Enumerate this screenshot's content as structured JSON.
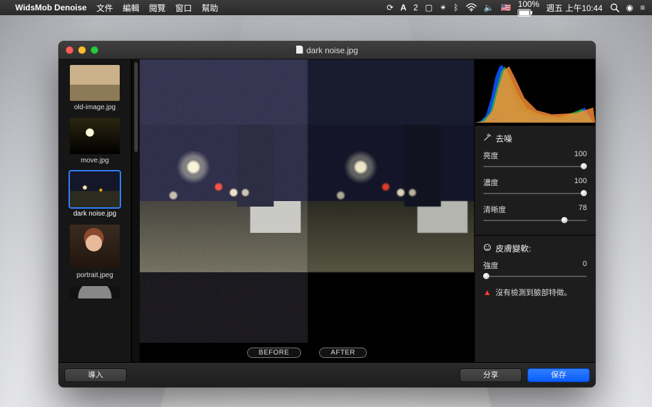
{
  "menubar": {
    "app": "WidsMob Denoise",
    "items": [
      "文件",
      "編輯",
      "閱覽",
      "窗口",
      "幫助"
    ],
    "status": {
      "network_icon": "wifi-icon",
      "flag": "🇺🇸",
      "battery": "100%",
      "charging_icon": "⚡",
      "datetime": "週五 上午10:44"
    }
  },
  "window": {
    "title": "dark noise.jpg"
  },
  "thumbnails": [
    {
      "label": "old-image.jpg",
      "cls": "th-old"
    },
    {
      "label": "move.jpg",
      "cls": "th-move"
    },
    {
      "label": "dark noise.jpg",
      "cls": "th-dark",
      "selected": true
    },
    {
      "label": "portrait.jpeg",
      "cls": "th-port",
      "tall": true
    }
  ],
  "preview": {
    "before_label": "BEFORE",
    "after_label": "AFTER"
  },
  "histogram": {
    "readouts": [
      "---",
      "---",
      "---"
    ]
  },
  "controls": {
    "denoise": {
      "heading": "去噪",
      "luminance": {
        "label": "亮度",
        "value": 100
      },
      "chroma": {
        "label": "濃度",
        "value": 100
      },
      "sharpness": {
        "label": "清晰度",
        "value": 78
      }
    },
    "skin": {
      "heading": "皮膚變軟:",
      "intensity": {
        "label": "強度",
        "value": 0
      },
      "warning": "沒有檢測到臉部特徵。"
    }
  },
  "buttons": {
    "import": "導入",
    "share": "分享",
    "save": "保存"
  }
}
